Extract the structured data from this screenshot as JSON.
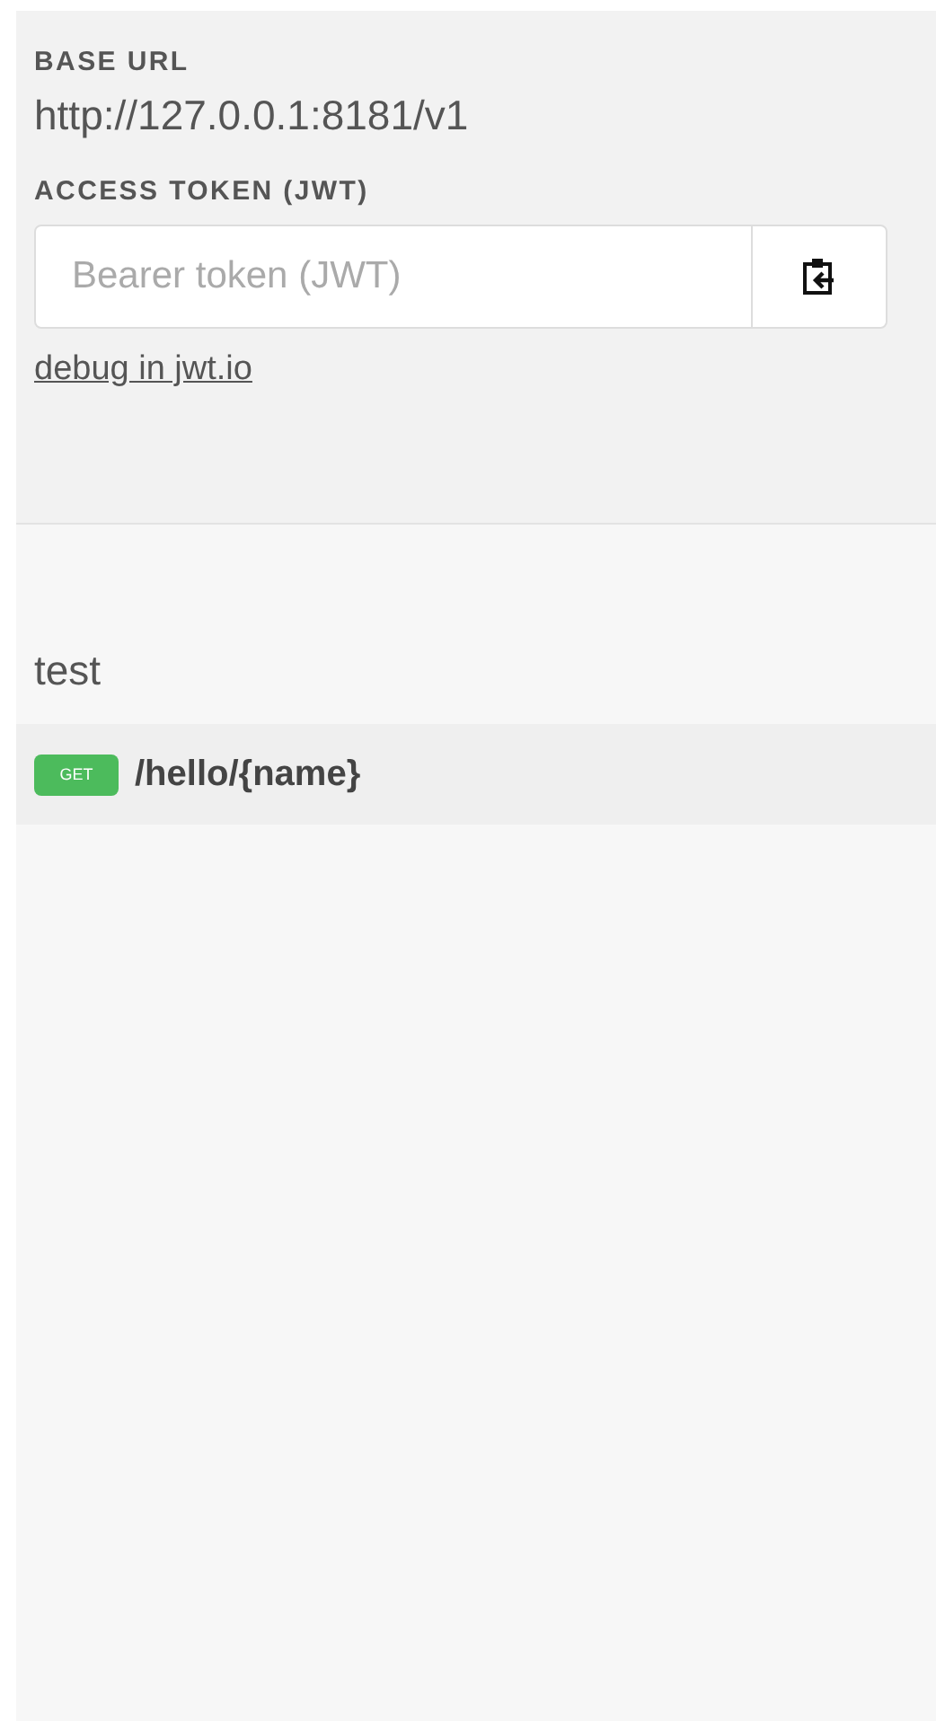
{
  "base_url": {
    "label": "BASE URL",
    "value": "http://127.0.0.1:8181/v1"
  },
  "access_token": {
    "label": "ACCESS TOKEN (JWT)",
    "placeholder": "Bearer token (JWT)",
    "link": "debug in jwt.io"
  },
  "groups": [
    {
      "title": "test",
      "endpoints": [
        {
          "method": "GET",
          "color": "#4cbb5c",
          "path": "/hello/{name}"
        }
      ]
    }
  ]
}
